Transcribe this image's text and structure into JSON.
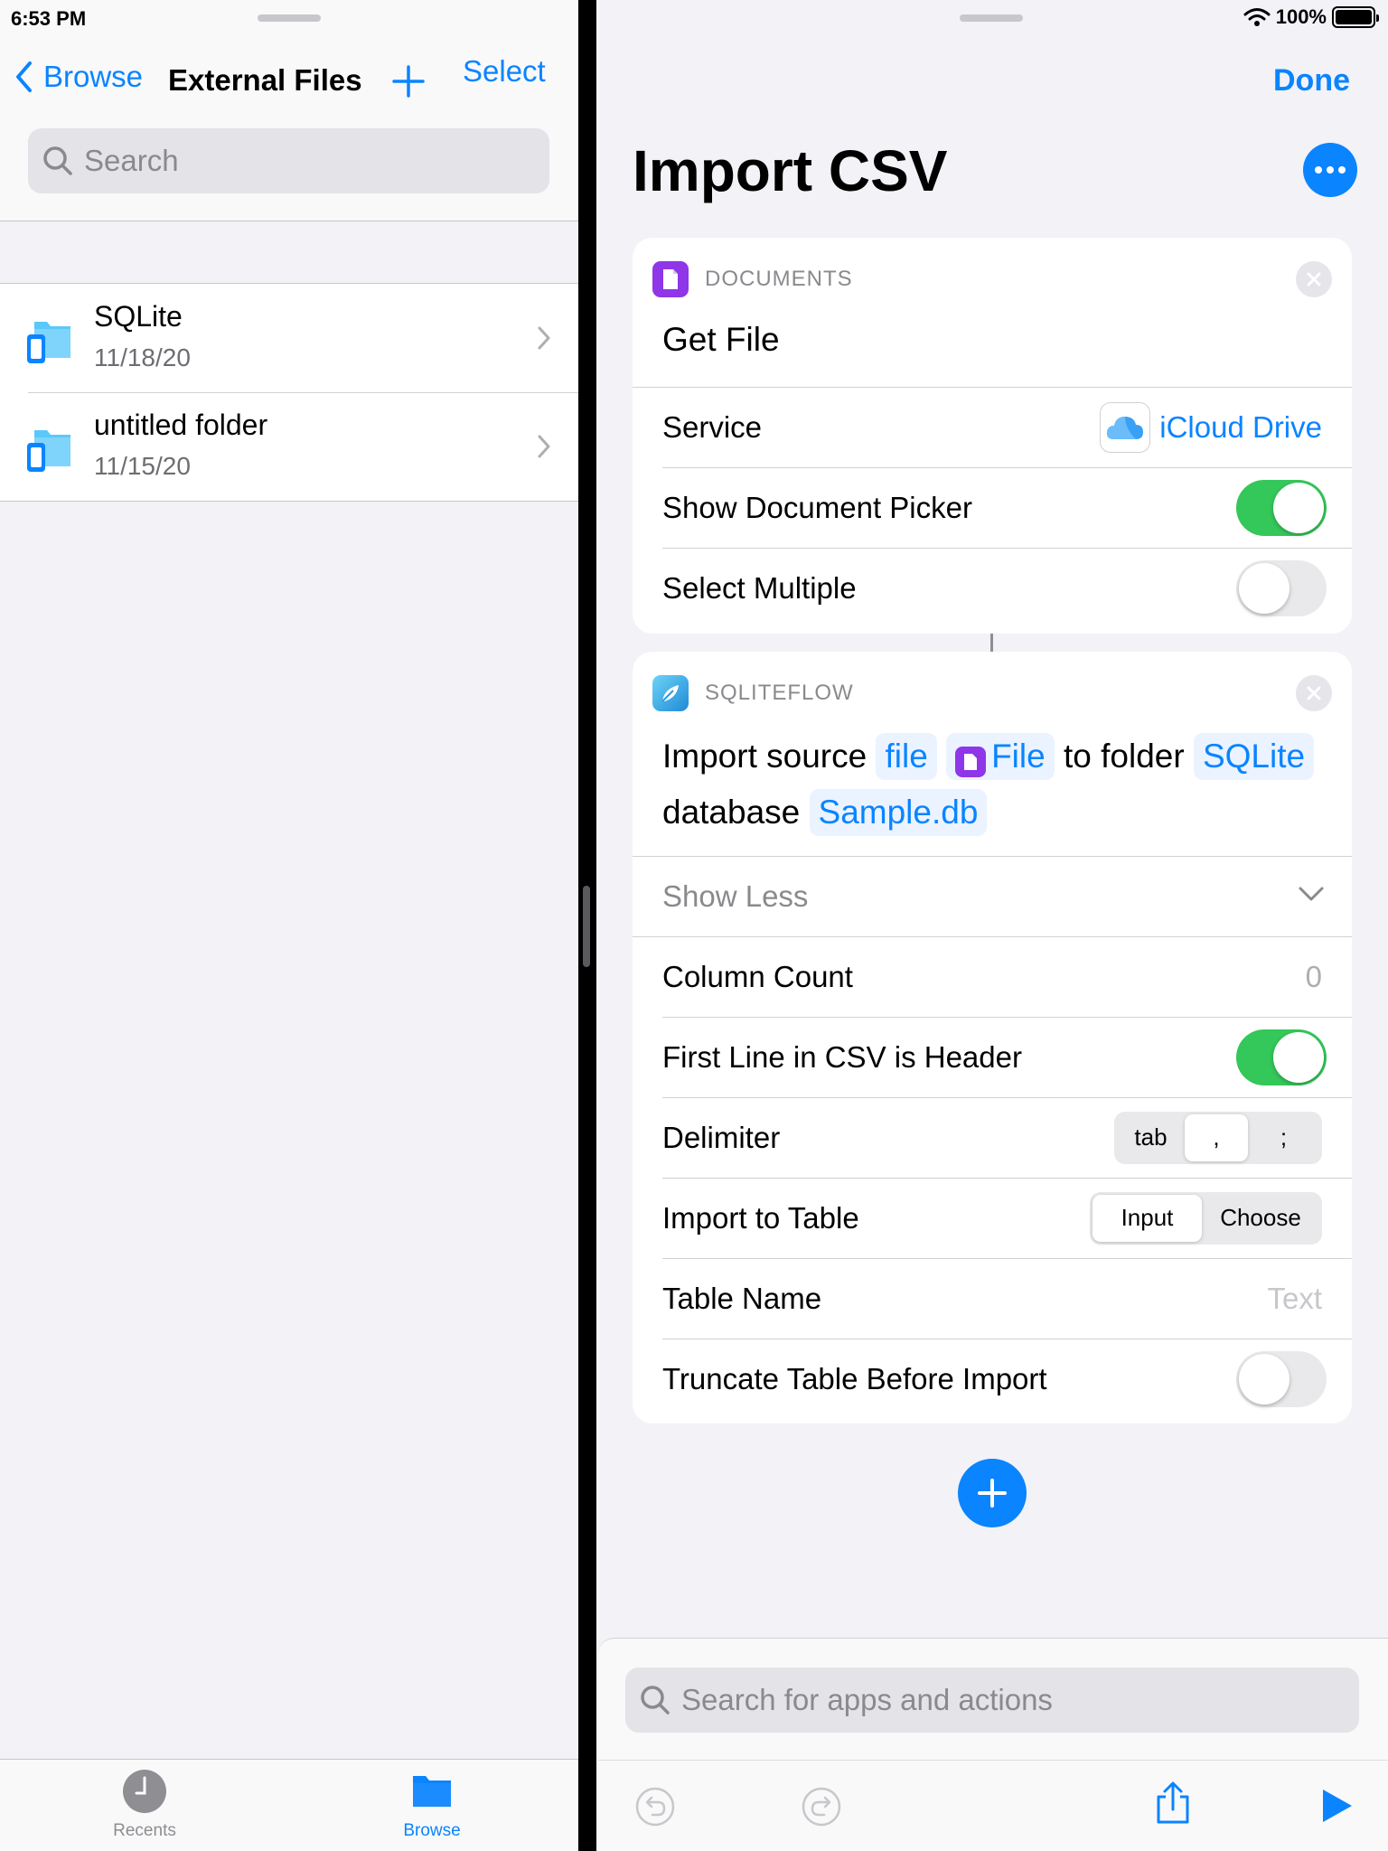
{
  "status": {
    "time": "6:53 PM",
    "battery": "100%"
  },
  "files": {
    "back_label": "Browse",
    "title": "External Files",
    "select_label": "Select",
    "search_placeholder": "Search",
    "items": [
      {
        "name": "SQLite",
        "date": "11/18/20"
      },
      {
        "name": "untitled folder",
        "date": "11/15/20"
      }
    ],
    "tabs": {
      "recents": "Recents",
      "browse": "Browse"
    }
  },
  "shortcut": {
    "done_label": "Done",
    "title": "Import CSV",
    "card1": {
      "app": "DOCUMENTS",
      "action": "Get File",
      "service_label": "Service",
      "service_value": "iCloud Drive",
      "show_picker_label": "Show Document Picker",
      "show_picker_on": true,
      "select_multiple_label": "Select Multiple",
      "select_multiple_on": false
    },
    "card2": {
      "app": "SQLITEFLOW",
      "sentence": {
        "p1": "Import source",
        "t1": "file",
        "t2": "File",
        "p2": "to folder",
        "t3": "SQLite",
        "p3": "database",
        "t4": "Sample.db"
      },
      "show_less": "Show Less",
      "column_count_label": "Column Count",
      "column_count_placeholder": "0",
      "header_label": "First Line in CSV is Header",
      "header_on": true,
      "delimiter_label": "Delimiter",
      "delimiter_options": [
        "tab",
        ",",
        ";"
      ],
      "delimiter_selected": ",",
      "import_table_label": "Import to Table",
      "import_table_options": [
        "Input",
        "Choose"
      ],
      "import_table_selected": "Input",
      "table_name_label": "Table Name",
      "table_name_placeholder": "Text",
      "truncate_label": "Truncate Table Before Import",
      "truncate_on": false
    },
    "actions_search_placeholder": "Search for apps and actions"
  },
  "colors": {
    "accent": "#0a84ff",
    "toggle_on": "#34c759",
    "documents_purple": "#8e36e8"
  }
}
